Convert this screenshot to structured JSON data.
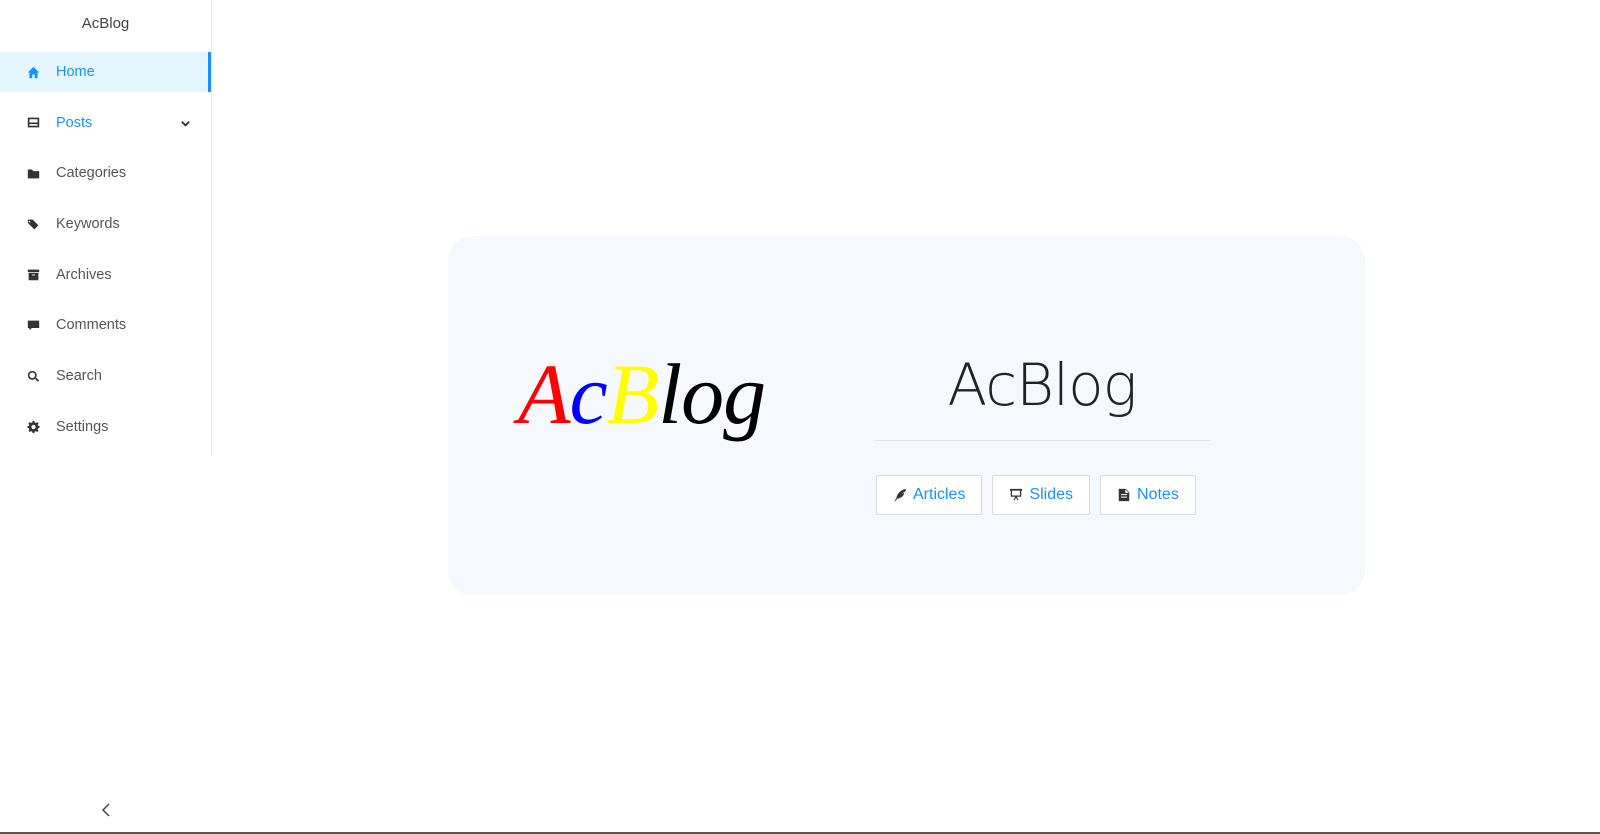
{
  "sidebar": {
    "brand": "AcBlog",
    "items": [
      {
        "label": "Home",
        "icon": "home-icon"
      },
      {
        "label": "Posts",
        "icon": "inbox-icon"
      },
      {
        "label": "Categories",
        "icon": "folder-icon"
      },
      {
        "label": "Keywords",
        "icon": "tags-icon"
      },
      {
        "label": "Archives",
        "icon": "archive-icon"
      },
      {
        "label": "Comments",
        "icon": "comment-icon"
      },
      {
        "label": "Search",
        "icon": "search-icon"
      },
      {
        "label": "Settings",
        "icon": "gear-icon"
      }
    ],
    "active_item": "Home",
    "collapse_icon": "chevron-left-icon"
  },
  "hero": {
    "logo": {
      "letters": [
        "A",
        "c",
        "B",
        "log"
      ],
      "colors": [
        "#ff0000",
        "#0000ff",
        "#ffff00",
        "#000000"
      ]
    },
    "title": "AcBlog",
    "buttons": [
      {
        "label": "Articles",
        "icon": "feather-icon"
      },
      {
        "label": "Slides",
        "icon": "presentation-icon"
      },
      {
        "label": "Notes",
        "icon": "file-text-icon"
      }
    ]
  },
  "colors": {
    "accent": "#1890ff",
    "active_bg": "#e6f6ff",
    "hero_bg": "#f5f9fd"
  }
}
